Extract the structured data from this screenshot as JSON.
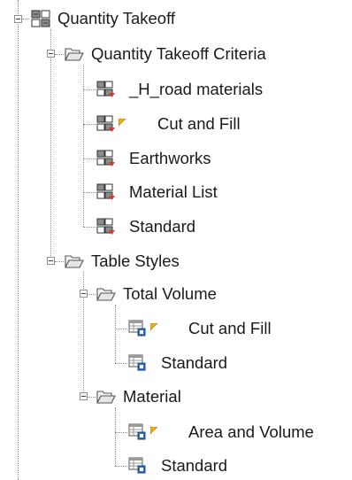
{
  "tree": {
    "root": {
      "label": "Quantity Takeoff",
      "icon": "quantity-takeoff-icon"
    },
    "criteria": {
      "label": "Quantity Takeoff Criteria",
      "icon": "folder-open-icon",
      "items": [
        {
          "label": "_H_road materials",
          "icon": "takeoff-criteria-icon",
          "modified": false
        },
        {
          "label": "Cut and Fill",
          "icon": "takeoff-criteria-icon",
          "modified": true
        },
        {
          "label": "Earthworks",
          "icon": "takeoff-criteria-icon",
          "modified": false
        },
        {
          "label": "Material List",
          "icon": "takeoff-criteria-icon",
          "modified": false
        },
        {
          "label": "Standard",
          "icon": "takeoff-criteria-icon",
          "modified": false
        }
      ]
    },
    "table_styles": {
      "label": "Table Styles",
      "icon": "folder-open-icon",
      "groups": [
        {
          "label": "Total Volume",
          "icon": "folder-open-icon",
          "items": [
            {
              "label": "Cut and Fill",
              "icon": "table-style-icon",
              "modified": true
            },
            {
              "label": "Standard",
              "icon": "table-style-icon",
              "modified": false
            }
          ]
        },
        {
          "label": "Material",
          "icon": "folder-open-icon",
          "items": [
            {
              "label": "Area and Volume",
              "icon": "table-style-icon",
              "modified": true
            },
            {
              "label": "Standard",
              "icon": "table-style-icon",
              "modified": false
            }
          ]
        }
      ]
    }
  }
}
